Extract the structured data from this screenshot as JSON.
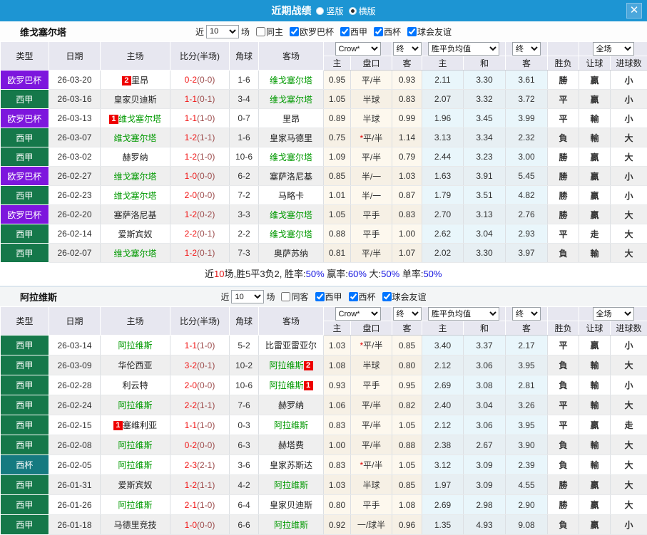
{
  "topbar": {
    "title": "近期战绩",
    "close_glyph": "✕",
    "radios": [
      {
        "label": "竖版",
        "selected": false
      },
      {
        "label": "横版",
        "selected": true
      }
    ]
  },
  "colors": {
    "titlebar_blue": "#1d95d3",
    "badge_red": "#ee0000",
    "team_green": "#009900",
    "win_red": "#d40000",
    "draw_blue": "#1414cc",
    "lose_green": "#0a820a",
    "type_colors": {
      "欧罗巴杯": "#7d16dd",
      "西甲": "#15784a",
      "西杯": "#157a80"
    }
  },
  "sections": [
    {
      "team": "维戈塞尔塔",
      "filter": {
        "near": "近",
        "count": "10",
        "unit": "场",
        "checks": [
          {
            "label": "同主",
            "checked": false
          },
          {
            "label": "欧罗巴杯",
            "checked": true
          },
          {
            "label": "西甲",
            "checked": true
          },
          {
            "label": "西杯",
            "checked": true
          },
          {
            "label": "球会友谊",
            "checked": true
          }
        ]
      },
      "header": {
        "cols": [
          "类型",
          "日期",
          "主场",
          "比分(半场)",
          "角球",
          "客场"
        ],
        "sub": [
          "主",
          "盘口",
          "客",
          "主",
          "和",
          "客",
          "胜负",
          "让球",
          "进球数"
        ],
        "selects": {
          "crow": "Crow*",
          "end1": "终",
          "avg": "胜平负均值",
          "end2": "终",
          "full": "全场"
        }
      },
      "rows": [
        {
          "type": "欧罗巴杯",
          "date": "26-03-20",
          "home": {
            "name": "里昂",
            "green": false,
            "badge": "2"
          },
          "score": {
            "ft": "0-2",
            "ht": "(0-0)"
          },
          "corner": "1-6",
          "away": {
            "name": "维戈塞尔塔",
            "green": true
          },
          "odds": {
            "home": "0.95",
            "hcap": "平/半",
            "away": "0.93"
          },
          "avg": {
            "home": "2.11",
            "draw": "3.30",
            "away": "3.61"
          },
          "result": {
            "t": "勝",
            "c": "r"
          },
          "handicap": {
            "t": "贏",
            "c": "r"
          },
          "goals": {
            "t": "小",
            "c": "g"
          }
        },
        {
          "type": "西甲",
          "date": "26-03-16",
          "home": {
            "name": "皇家贝迪斯",
            "green": false
          },
          "score": {
            "ft": "1-1",
            "ht": "(0-1)"
          },
          "corner": "3-4",
          "away": {
            "name": "维戈塞尔塔",
            "green": true
          },
          "odds": {
            "home": "1.05",
            "hcap": "半球",
            "away": "0.83"
          },
          "avg": {
            "home": "2.07",
            "draw": "3.32",
            "away": "3.72"
          },
          "result": {
            "t": "平",
            "c": "b"
          },
          "handicap": {
            "t": "贏",
            "c": "r"
          },
          "goals": {
            "t": "小",
            "c": "g"
          }
        },
        {
          "type": "欧罗巴杯",
          "date": "26-03-13",
          "home": {
            "name": "维戈塞尔塔",
            "green": true,
            "badge": "1"
          },
          "score": {
            "ft": "1-1",
            "ht": "(1-0)"
          },
          "corner": "0-7",
          "away": {
            "name": "里昂",
            "green": false
          },
          "odds": {
            "home": "0.89",
            "hcap": "半球",
            "away": "0.99"
          },
          "avg": {
            "home": "1.96",
            "draw": "3.45",
            "away": "3.99"
          },
          "result": {
            "t": "平",
            "c": "b"
          },
          "handicap": {
            "t": "輸",
            "c": "g"
          },
          "goals": {
            "t": "小",
            "c": "g"
          }
        },
        {
          "type": "西甲",
          "date": "26-03-07",
          "home": {
            "name": "维戈塞尔塔",
            "green": true
          },
          "score": {
            "ft": "1-2",
            "ht": "(1-1)"
          },
          "corner": "1-6",
          "away": {
            "name": "皇家马德里",
            "green": false
          },
          "odds": {
            "home": "0.75",
            "star": "*",
            "hcap": "平/半",
            "away": "1.14"
          },
          "avg": {
            "home": "3.13",
            "draw": "3.34",
            "away": "2.32"
          },
          "result": {
            "t": "負",
            "c": "g"
          },
          "handicap": {
            "t": "輸",
            "c": "g"
          },
          "goals": {
            "t": "大",
            "c": "r"
          }
        },
        {
          "type": "西甲",
          "date": "26-03-02",
          "home": {
            "name": "赫罗纳",
            "green": false
          },
          "score": {
            "ft": "1-2",
            "ht": "(1-0)"
          },
          "corner": "10-6",
          "away": {
            "name": "维戈塞尔塔",
            "green": true
          },
          "odds": {
            "home": "1.09",
            "hcap": "平/半",
            "away": "0.79"
          },
          "avg": {
            "home": "2.44",
            "draw": "3.23",
            "away": "3.00"
          },
          "result": {
            "t": "勝",
            "c": "r"
          },
          "handicap": {
            "t": "贏",
            "c": "r"
          },
          "goals": {
            "t": "大",
            "c": "r"
          }
        },
        {
          "type": "欧罗巴杯",
          "date": "26-02-27",
          "home": {
            "name": "维戈塞尔塔",
            "green": true
          },
          "score": {
            "ft": "1-0",
            "ht": "(0-0)"
          },
          "corner": "6-2",
          "away": {
            "name": "塞萨洛尼基",
            "green": false
          },
          "odds": {
            "home": "0.85",
            "hcap": "半/一",
            "away": "1.03"
          },
          "avg": {
            "home": "1.63",
            "draw": "3.91",
            "away": "5.45"
          },
          "result": {
            "t": "勝",
            "c": "r"
          },
          "handicap": {
            "t": "贏",
            "c": "r"
          },
          "goals": {
            "t": "小",
            "c": "g"
          }
        },
        {
          "type": "西甲",
          "date": "26-02-23",
          "home": {
            "name": "维戈塞尔塔",
            "green": true
          },
          "score": {
            "ft": "2-0",
            "ht": "(0-0)"
          },
          "corner": "7-2",
          "away": {
            "name": "马略卡",
            "green": false
          },
          "odds": {
            "home": "1.01",
            "hcap": "半/一",
            "away": "0.87"
          },
          "avg": {
            "home": "1.79",
            "draw": "3.51",
            "away": "4.82"
          },
          "result": {
            "t": "勝",
            "c": "r"
          },
          "handicap": {
            "t": "贏",
            "c": "r"
          },
          "goals": {
            "t": "小",
            "c": "g"
          }
        },
        {
          "type": "欧罗巴杯",
          "date": "26-02-20",
          "home": {
            "name": "塞萨洛尼基",
            "green": false
          },
          "score": {
            "ft": "1-2",
            "ht": "(0-2)"
          },
          "corner": "3-3",
          "away": {
            "name": "维戈塞尔塔",
            "green": true
          },
          "odds": {
            "home": "1.05",
            "hcap": "平手",
            "away": "0.83"
          },
          "avg": {
            "home": "2.70",
            "draw": "3.13",
            "away": "2.76"
          },
          "result": {
            "t": "勝",
            "c": "r"
          },
          "handicap": {
            "t": "贏",
            "c": "r"
          },
          "goals": {
            "t": "大",
            "c": "r"
          }
        },
        {
          "type": "西甲",
          "date": "26-02-14",
          "home": {
            "name": "爱斯宾奴",
            "green": false
          },
          "score": {
            "ft": "2-2",
            "ht": "(0-1)"
          },
          "corner": "2-2",
          "away": {
            "name": "维戈塞尔塔",
            "green": true
          },
          "odds": {
            "home": "0.88",
            "hcap": "平手",
            "away": "1.00"
          },
          "avg": {
            "home": "2.62",
            "draw": "3.04",
            "away": "2.93"
          },
          "result": {
            "t": "平",
            "c": "b"
          },
          "handicap": {
            "t": "走",
            "c": "b"
          },
          "goals": {
            "t": "大",
            "c": "r"
          }
        },
        {
          "type": "西甲",
          "date": "26-02-07",
          "home": {
            "name": "维戈塞尔塔",
            "green": true
          },
          "score": {
            "ft": "1-2",
            "ht": "(0-1)"
          },
          "corner": "7-3",
          "away": {
            "name": "奥萨苏纳",
            "green": false
          },
          "odds": {
            "home": "0.81",
            "hcap": "平/半",
            "away": "1.07"
          },
          "avg": {
            "home": "2.02",
            "draw": "3.30",
            "away": "3.97"
          },
          "result": {
            "t": "負",
            "c": "g"
          },
          "handicap": {
            "t": "輸",
            "c": "g"
          },
          "goals": {
            "t": "大",
            "c": "r"
          }
        }
      ],
      "summary": {
        "pre": [
          {
            "t": "近",
            "c": "k"
          },
          {
            "t": "10",
            "c": "r"
          },
          {
            "t": "场,胜5平3负2, ",
            "c": "k"
          }
        ],
        "stats": [
          {
            "label": "胜率:",
            "value": "50%"
          },
          {
            "label": " 赢率:",
            "value": "60%"
          },
          {
            "label": " 大:",
            "value": "50%"
          },
          {
            "label": " 单率:",
            "value": "50%"
          }
        ]
      }
    },
    {
      "team": "阿拉维斯",
      "filter": {
        "near": "近",
        "count": "10",
        "unit": "场",
        "checks": [
          {
            "label": "同客",
            "checked": false
          },
          {
            "label": "西甲",
            "checked": true
          },
          {
            "label": "西杯",
            "checked": true
          },
          {
            "label": "球会友谊",
            "checked": true
          }
        ]
      },
      "header": {
        "cols": [
          "类型",
          "日期",
          "主场",
          "比分(半场)",
          "角球",
          "客场"
        ],
        "sub": [
          "主",
          "盘口",
          "客",
          "主",
          "和",
          "客",
          "胜负",
          "让球",
          "进球数"
        ],
        "selects": {
          "crow": "Crow*",
          "end1": "终",
          "avg": "胜平负均值",
          "end2": "终",
          "full": "全场"
        }
      },
      "rows": [
        {
          "type": "西甲",
          "date": "26-03-14",
          "home": {
            "name": "阿拉维斯",
            "green": true
          },
          "score": {
            "ft": "1-1",
            "ht": "(1-0)"
          },
          "corner": "5-2",
          "away": {
            "name": "比雷亚雷亚尔",
            "green": false
          },
          "odds": {
            "home": "1.03",
            "star": "*",
            "hcap": "平/半",
            "away": "0.85"
          },
          "avg": {
            "home": "3.40",
            "draw": "3.37",
            "away": "2.17"
          },
          "result": {
            "t": "平",
            "c": "b"
          },
          "handicap": {
            "t": "贏",
            "c": "r"
          },
          "goals": {
            "t": "小",
            "c": "g"
          }
        },
        {
          "type": "西甲",
          "date": "26-03-09",
          "home": {
            "name": "华伦西亚",
            "green": false
          },
          "score": {
            "ft": "3-2",
            "ht": "(0-1)"
          },
          "corner": "10-2",
          "away": {
            "name": "阿拉维斯",
            "green": true,
            "badge": "2"
          },
          "odds": {
            "home": "1.08",
            "hcap": "半球",
            "away": "0.80"
          },
          "avg": {
            "home": "2.12",
            "draw": "3.06",
            "away": "3.95"
          },
          "result": {
            "t": "負",
            "c": "g"
          },
          "handicap": {
            "t": "輸",
            "c": "g"
          },
          "goals": {
            "t": "大",
            "c": "r"
          }
        },
        {
          "type": "西甲",
          "date": "26-02-28",
          "home": {
            "name": "利云特",
            "green": false
          },
          "score": {
            "ft": "2-0",
            "ht": "(0-0)"
          },
          "corner": "10-6",
          "away": {
            "name": "阿拉维斯",
            "green": true,
            "badge": "1"
          },
          "odds": {
            "home": "0.93",
            "hcap": "平手",
            "away": "0.95"
          },
          "avg": {
            "home": "2.69",
            "draw": "3.08",
            "away": "2.81"
          },
          "result": {
            "t": "負",
            "c": "g"
          },
          "handicap": {
            "t": "輸",
            "c": "g"
          },
          "goals": {
            "t": "小",
            "c": "g"
          }
        },
        {
          "type": "西甲",
          "date": "26-02-24",
          "home": {
            "name": "阿拉维斯",
            "green": true
          },
          "score": {
            "ft": "2-2",
            "ht": "(1-1)"
          },
          "corner": "7-6",
          "away": {
            "name": "赫罗纳",
            "green": false
          },
          "odds": {
            "home": "1.06",
            "hcap": "平/半",
            "away": "0.82"
          },
          "avg": {
            "home": "2.40",
            "draw": "3.04",
            "away": "3.26"
          },
          "result": {
            "t": "平",
            "c": "b"
          },
          "handicap": {
            "t": "輸",
            "c": "g"
          },
          "goals": {
            "t": "大",
            "c": "r"
          }
        },
        {
          "type": "西甲",
          "date": "26-02-15",
          "home": {
            "name": "塞维利亚",
            "green": false,
            "badge": "1"
          },
          "score": {
            "ft": "1-1",
            "ht": "(1-0)"
          },
          "corner": "0-3",
          "away": {
            "name": "阿拉维斯",
            "green": true
          },
          "odds": {
            "home": "0.83",
            "hcap": "平/半",
            "away": "1.05"
          },
          "avg": {
            "home": "2.12",
            "draw": "3.06",
            "away": "3.95"
          },
          "result": {
            "t": "平",
            "c": "b"
          },
          "handicap": {
            "t": "贏",
            "c": "r"
          },
          "goals": {
            "t": "走",
            "c": "b"
          }
        },
        {
          "type": "西甲",
          "date": "26-02-08",
          "home": {
            "name": "阿拉维斯",
            "green": true
          },
          "score": {
            "ft": "0-2",
            "ht": "(0-0)"
          },
          "corner": "6-3",
          "away": {
            "name": "赫塔费",
            "green": false
          },
          "odds": {
            "home": "1.00",
            "hcap": "平/半",
            "away": "0.88"
          },
          "avg": {
            "home": "2.38",
            "draw": "2.67",
            "away": "3.90"
          },
          "result": {
            "t": "負",
            "c": "g"
          },
          "handicap": {
            "t": "輸",
            "c": "g"
          },
          "goals": {
            "t": "大",
            "c": "r"
          }
        },
        {
          "type": "西杯",
          "date": "26-02-05",
          "home": {
            "name": "阿拉维斯",
            "green": true
          },
          "score": {
            "ft": "2-3",
            "ht": "(2-1)"
          },
          "corner": "3-6",
          "away": {
            "name": "皇家苏斯达",
            "green": false
          },
          "odds": {
            "home": "0.83",
            "star": "*",
            "hcap": "平/半",
            "away": "1.05"
          },
          "avg": {
            "home": "3.12",
            "draw": "3.09",
            "away": "2.39"
          },
          "result": {
            "t": "負",
            "c": "g"
          },
          "handicap": {
            "t": "輸",
            "c": "g"
          },
          "goals": {
            "t": "大",
            "c": "r"
          }
        },
        {
          "type": "西甲",
          "date": "26-01-31",
          "home": {
            "name": "爱斯宾奴",
            "green": false
          },
          "score": {
            "ft": "1-2",
            "ht": "(1-1)"
          },
          "corner": "4-2",
          "away": {
            "name": "阿拉维斯",
            "green": true
          },
          "odds": {
            "home": "1.03",
            "hcap": "半球",
            "away": "0.85"
          },
          "avg": {
            "home": "1.97",
            "draw": "3.09",
            "away": "4.55"
          },
          "result": {
            "t": "勝",
            "c": "r"
          },
          "handicap": {
            "t": "贏",
            "c": "r"
          },
          "goals": {
            "t": "大",
            "c": "r"
          }
        },
        {
          "type": "西甲",
          "date": "26-01-26",
          "home": {
            "name": "阿拉维斯",
            "green": true
          },
          "score": {
            "ft": "2-1",
            "ht": "(1-0)"
          },
          "corner": "6-4",
          "away": {
            "name": "皇家贝迪斯",
            "green": false
          },
          "odds": {
            "home": "0.80",
            "hcap": "平手",
            "away": "1.08"
          },
          "avg": {
            "home": "2.69",
            "draw": "2.98",
            "away": "2.90"
          },
          "result": {
            "t": "勝",
            "c": "r"
          },
          "handicap": {
            "t": "贏",
            "c": "r"
          },
          "goals": {
            "t": "大",
            "c": "r"
          }
        },
        {
          "type": "西甲",
          "date": "26-01-18",
          "home": {
            "name": "马德里竞技",
            "green": false
          },
          "score": {
            "ft": "1-0",
            "ht": "(0-0)"
          },
          "corner": "6-6",
          "away": {
            "name": "阿拉维斯",
            "green": true
          },
          "odds": {
            "home": "0.92",
            "hcap": "一/球半",
            "away": "0.96"
          },
          "avg": {
            "home": "1.35",
            "draw": "4.93",
            "away": "9.08"
          },
          "result": {
            "t": "負",
            "c": "g"
          },
          "handicap": {
            "t": "贏",
            "c": "r"
          },
          "goals": {
            "t": "小",
            "c": "g"
          }
        }
      ]
    }
  ]
}
